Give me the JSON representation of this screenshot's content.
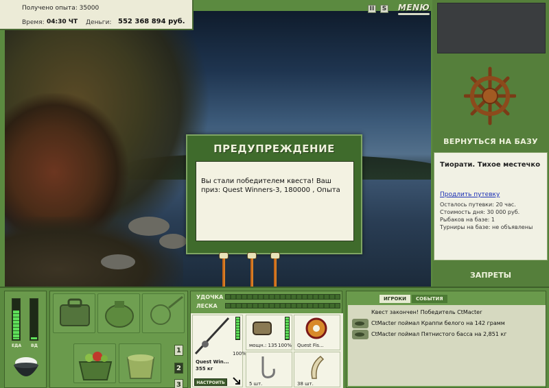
{
  "status": {
    "experience": "Получено опыта: 35000",
    "time_label": "Время:",
    "time_value": "04:30 ЧТ",
    "money_label": "Деньги:",
    "money_value": "552 368 894 руб."
  },
  "topbar": {
    "pause_label": "II",
    "sound_label": "S",
    "menu_label": "MENЮ"
  },
  "dialog": {
    "title": "ПРЕДУПРЕЖДЕНИЕ",
    "message": "Вы стали победителем квеста! Ваш приз: Quest Winners-3, 180000 , Опыта"
  },
  "right_panel": {
    "return_label": "ВЕРНУТЬСЯ НА БАЗУ",
    "location_title": "Тиорати. Тихое местечко",
    "extend_link": "Продлить путевку",
    "info": [
      "Осталось путевки: 20 час.",
      "Стоимость дня: 30 000 руб.",
      "Рыбаков на базе: 1",
      "Турниры на базе: не объявлены"
    ],
    "bans_label": "ЗАПРЕТЫ"
  },
  "meters": {
    "food_label": "ЕДА",
    "vodka_label": "ВД",
    "food_level": 0.72,
    "vodka_level": 0.05
  },
  "inventory": {
    "pages": [
      "1",
      "2",
      "3"
    ],
    "selected_page": "2"
  },
  "tackle": {
    "rod_label": "УДОЧКА",
    "line_label": "ЛЕСКА",
    "rod_name": "Quest Win...",
    "rod_weight": "355 кг",
    "rod_percent": "100%",
    "reel_caption": "мощн.: 135",
    "reel_percent": "100%",
    "line_caption": "Quest Fis...",
    "hook_caption": "5 шт.",
    "bait_caption": "38 шт.",
    "setup_label": "НАСТРОИТЬ"
  },
  "chat": {
    "tabs": [
      "ИГРОКИ",
      "СОБЫТИЯ"
    ],
    "messages": [
      "Квест закончен! Победитель CtMacter",
      "CtMacter поймал Краппи белого на 142 грамм",
      "CtMacter поймал Пятнистого басса на 2,851 кг"
    ]
  }
}
